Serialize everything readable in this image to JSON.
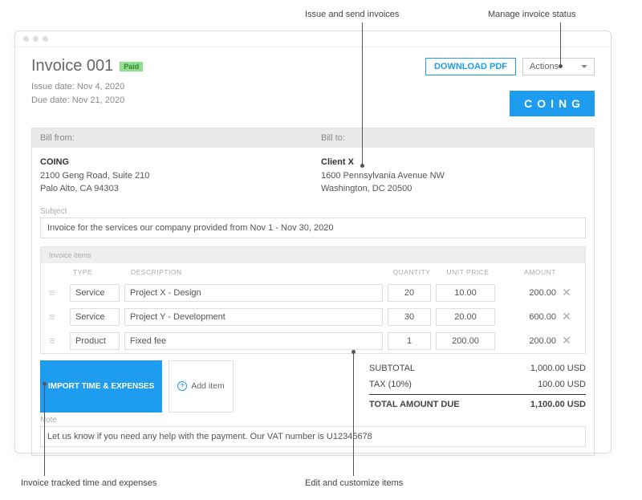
{
  "annotations": {
    "a1": "Issue and send invoices",
    "a2": "Manage invoice status",
    "a3": "Invoice tracked time and expenses",
    "a4": "Edit and customize items"
  },
  "header": {
    "title": "Invoice 001",
    "badge": "Paid",
    "download": "DOWNLOAD PDF",
    "actions": "Actions"
  },
  "dates": {
    "issue": "Issue date: Nov 4, 2020",
    "due": "Due date: Nov 21, 2020"
  },
  "brand": "COING",
  "bill": {
    "from_label": "Bill from:",
    "to_label": "Bill to:",
    "from_name": "COING",
    "from_addr1": "2100 Geng Road, Suite 210",
    "from_addr2": "Palo Alto, CA 94303",
    "to_name": "Client X",
    "to_addr1": "1600 Pennsylvania Avenue NW",
    "to_addr2": "Washington, DC 20500"
  },
  "subject": {
    "label": "Subject",
    "value": "Invoice for the services our company provided from Nov 1 - Nov 30, 2020"
  },
  "items": {
    "panel_label": "Invoice items",
    "cols": {
      "type": "TYPE",
      "desc": "DESCRIPTION",
      "qty": "QUANTITY",
      "unit": "UNIT PRICE",
      "amt": "AMOUNT"
    },
    "rows": [
      {
        "type": "Service",
        "desc": "Project X - Design",
        "qty": "20",
        "unit": "10.00",
        "amt": "200.00"
      },
      {
        "type": "Service",
        "desc": "Project Y - Development",
        "qty": "30",
        "unit": "20.00",
        "amt": "600.00"
      },
      {
        "type": "Product",
        "desc": "Fixed fee",
        "qty": "1",
        "unit": "200.00",
        "amt": "200.00"
      }
    ]
  },
  "actions": {
    "import": "IMPORT TIME & EXPENSES",
    "add": "Add item"
  },
  "totals": {
    "subtotal_label": "SUBTOTAL",
    "subtotal": "1,000.00 USD",
    "tax_label": "TAX  (10%)",
    "tax": "100.00 USD",
    "due_label": "TOTAL AMOUNT DUE",
    "due": "1,100.00 USD"
  },
  "note": {
    "label": "Note",
    "value": "Let us know if you need any help with the payment. Our VAT number is U12345678"
  }
}
